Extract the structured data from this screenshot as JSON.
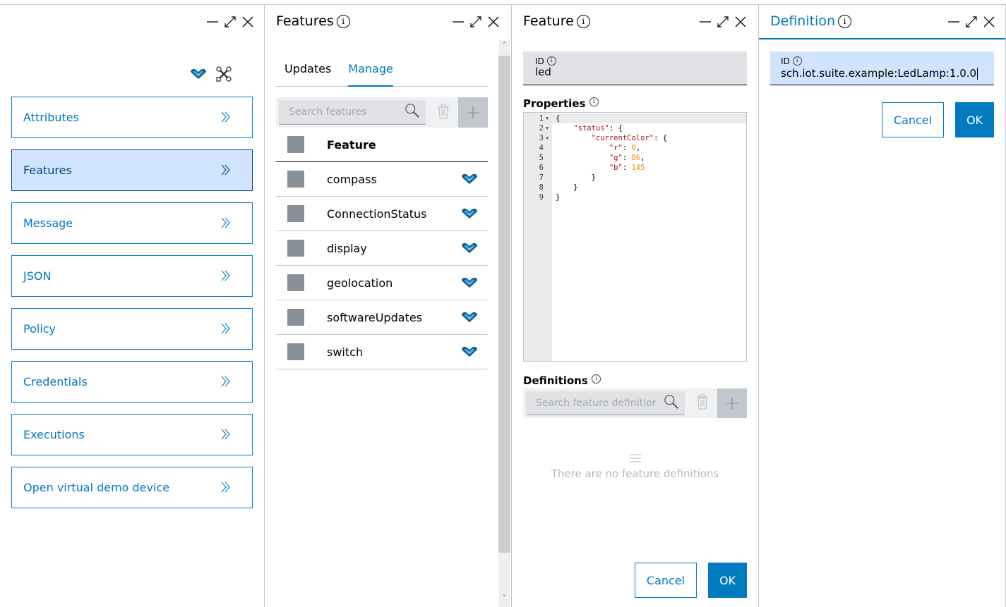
{
  "left_panel": {
    "nav_items": [
      {
        "label": "Attributes",
        "active": false
      },
      {
        "label": "Features",
        "active": true
      },
      {
        "label": "Message",
        "active": false
      },
      {
        "label": "JSON",
        "active": false
      },
      {
        "label": "Policy",
        "active": false
      },
      {
        "label": "Credentials",
        "active": false
      },
      {
        "label": "Executions",
        "active": false
      },
      {
        "label": "Open virtual demo device",
        "active": false
      }
    ],
    "chevron": "»"
  },
  "features_panel": {
    "title": "Features",
    "tabs": [
      {
        "label": "Updates",
        "active": false
      },
      {
        "label": "Manage",
        "active": true
      }
    ],
    "search_placeholder": "Search features",
    "column_header": "Feature",
    "rows": [
      {
        "name": "compass"
      },
      {
        "name": "ConnectionStatus"
      },
      {
        "name": "display"
      },
      {
        "name": "geolocation"
      },
      {
        "name": "softwareUpdates"
      },
      {
        "name": "switch"
      }
    ]
  },
  "feature_panel": {
    "title": "Feature",
    "id_label": "ID",
    "id_value": "led",
    "properties_label": "Properties",
    "code_lines": [
      {
        "n": "1",
        "fold": true
      },
      {
        "n": "2",
        "fold": true
      },
      {
        "n": "3",
        "fold": true
      },
      {
        "n": "4",
        "fold": false
      },
      {
        "n": "5",
        "fold": false
      },
      {
        "n": "6",
        "fold": false
      },
      {
        "n": "7",
        "fold": false
      },
      {
        "n": "8",
        "fold": false
      },
      {
        "n": "9",
        "fold": false
      }
    ],
    "properties_json": {
      "status": {
        "currentColor": {
          "r": 0,
          "g": 86,
          "b": 145
        }
      }
    },
    "definitions_label": "Definitions",
    "definitions_search_placeholder": "Search feature definitior",
    "empty_text": "There are no feature definitions",
    "cancel_label": "Cancel",
    "ok_label": "OK"
  },
  "definition_panel": {
    "title": "Definition",
    "id_label": "ID",
    "id_value": "sch.iot.suite.example:LedLamp:1.0.0",
    "cancel_label": "Cancel",
    "ok_label": "OK"
  },
  "colors": {
    "accent": "#007bc0",
    "active_bg": "#d1e4ff",
    "code_key": "#a31515",
    "code_number": "#f08c00"
  }
}
